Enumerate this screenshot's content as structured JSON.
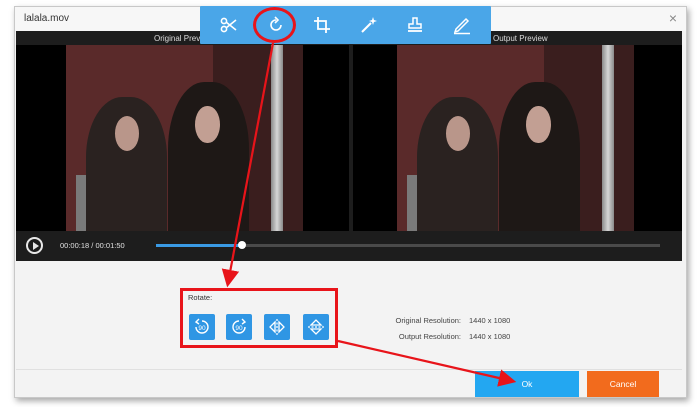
{
  "window": {
    "title": "lalala.mov",
    "close_glyph": "×"
  },
  "toolbar": {
    "tools": [
      {
        "icon": "scissors-icon",
        "glyph": "✂"
      },
      {
        "icon": "rotate-icon",
        "glyph": "⟳"
      },
      {
        "icon": "crop-icon",
        "glyph": "⌗"
      },
      {
        "icon": "magic-wand-icon",
        "glyph": "✨"
      },
      {
        "icon": "stamp-icon",
        "glyph": "⎍"
      },
      {
        "icon": "subtitle-edit-icon",
        "glyph": "✎"
      }
    ],
    "active_tool": "rotate-icon"
  },
  "preview": {
    "original_label": "Original Preview",
    "output_label": "Output Preview"
  },
  "player": {
    "current_time": "00:00:18",
    "separator": "/",
    "total_time": "00:01:50",
    "progress": 0.17
  },
  "rotate": {
    "label": "Rotate:",
    "buttons": [
      {
        "icon": "rotate-left-90-icon",
        "text": "90"
      },
      {
        "icon": "rotate-right-90-icon",
        "text": "90"
      },
      {
        "icon": "flip-horizontal-icon",
        "text": ""
      },
      {
        "icon": "flip-vertical-icon",
        "text": ""
      }
    ]
  },
  "resolution": {
    "original_label": "Original Resolution:",
    "original_value": "1440 x 1080",
    "output_label": "Output Resolution:",
    "output_value": "1440 x 1080"
  },
  "actions": {
    "ok": "Ok",
    "cancel": "Cancel"
  },
  "colors": {
    "accent": "#4aa6e8",
    "annotation": "#e8141a",
    "ok": "#23a7f1",
    "cancel": "#f26b1d"
  }
}
